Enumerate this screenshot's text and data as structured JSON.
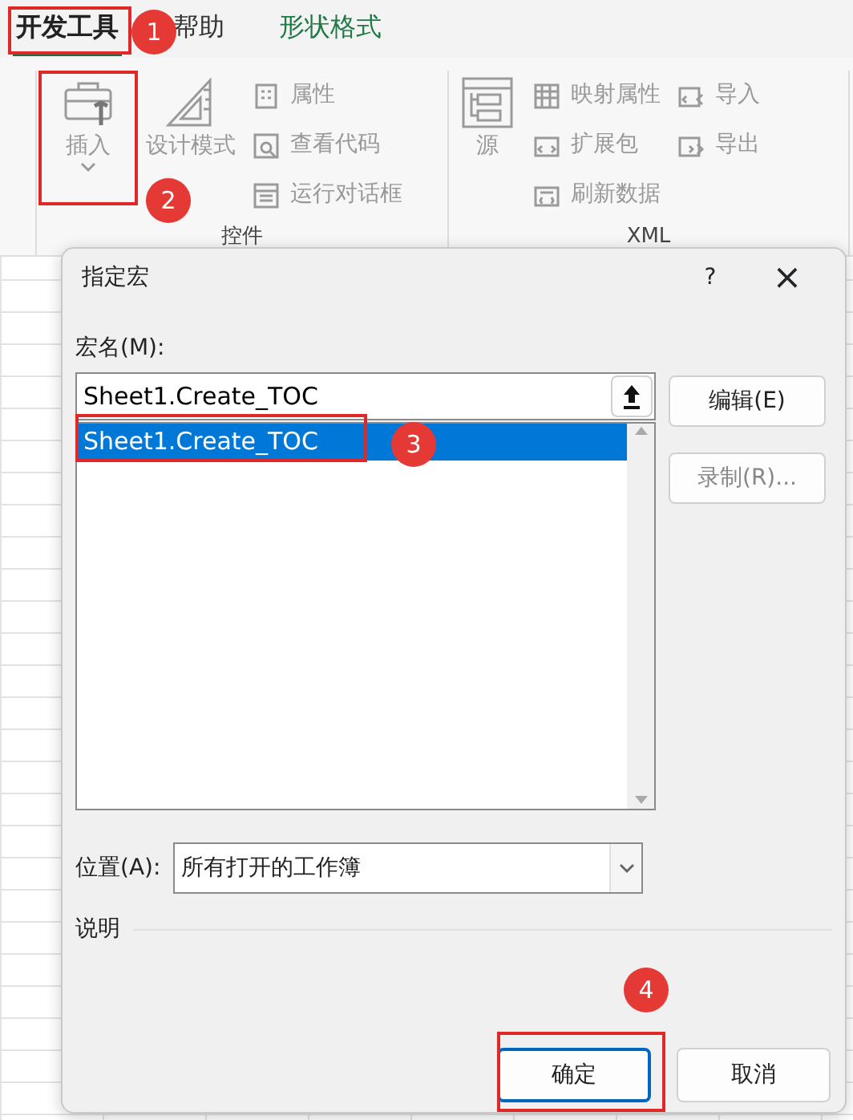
{
  "tabs": [
    {
      "label": "开发工具",
      "selected": true,
      "kind": "normal"
    },
    {
      "label": "帮助",
      "selected": false,
      "kind": "normal"
    },
    {
      "label": "形状格式",
      "selected": false,
      "kind": "contextual"
    }
  ],
  "ribbon": {
    "groups": [
      {
        "label": "控件",
        "items": [
          {
            "kind": "large",
            "label": "插入",
            "dropdown": true
          },
          {
            "kind": "large",
            "label": "设计模式",
            "dropdown": false
          },
          {
            "kind": "small",
            "label": "属性"
          },
          {
            "kind": "small",
            "label": "查看代码"
          },
          {
            "kind": "small",
            "label": "运行对话框"
          }
        ]
      },
      {
        "label": "XML",
        "items": [
          {
            "kind": "large",
            "label": "源",
            "dropdown": false
          },
          {
            "kind": "small",
            "label": "映射属性"
          },
          {
            "kind": "small",
            "label": "扩展包"
          },
          {
            "kind": "small",
            "label": "刷新数据"
          },
          {
            "kind": "small",
            "label": "导入"
          },
          {
            "kind": "small",
            "label": "导出"
          }
        ]
      }
    ]
  },
  "dialog": {
    "title": "指定宏",
    "help": "?",
    "close": "×",
    "name_label": "宏名(M):",
    "name_value": "Sheet1.Create_TOC",
    "macros": [
      {
        "text": "Sheet1.Create_TOC",
        "selected": true
      }
    ],
    "side_buttons": [
      {
        "label": "编辑(E)",
        "disabled": false
      },
      {
        "label": "录制(R)...",
        "disabled": true
      }
    ],
    "location_label": "位置(A):",
    "location_value": "所有打开的工作簿",
    "description_label": "说明",
    "buttons": [
      {
        "label": "确定",
        "default": true
      },
      {
        "label": "取消",
        "default": false
      }
    ]
  },
  "annotations": [
    {
      "label": "1"
    },
    {
      "label": "2"
    },
    {
      "label": "3"
    },
    {
      "label": "4"
    }
  ]
}
